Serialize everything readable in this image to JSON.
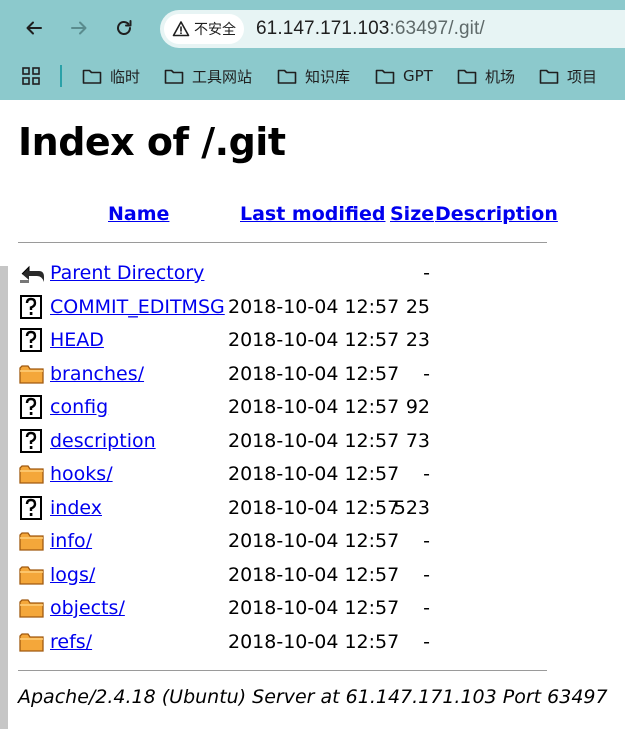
{
  "browser": {
    "security_label": "不安全",
    "url_host": "61.147.171.103",
    "url_rest": ":63497/.git/",
    "bookmarks": [
      {
        "label": "临时"
      },
      {
        "label": "工具网站"
      },
      {
        "label": "知识库"
      },
      {
        "label": "GPT"
      },
      {
        "label": "机场"
      },
      {
        "label": "项目"
      }
    ]
  },
  "page": {
    "title": "Index of /.git",
    "columns": {
      "name": "Name",
      "last_modified": "Last modified",
      "size": "Size",
      "description": "Description"
    },
    "rows": [
      {
        "icon": "back-icon",
        "name": "Parent Directory",
        "date": "",
        "size": "-"
      },
      {
        "icon": "unknown-file-icon",
        "name": "COMMIT_EDITMSG",
        "date": "2018-10-04 12:57",
        "size": "25"
      },
      {
        "icon": "unknown-file-icon",
        "name": "HEAD",
        "date": "2018-10-04 12:57",
        "size": "23"
      },
      {
        "icon": "folder-icon",
        "name": "branches/",
        "date": "2018-10-04 12:57",
        "size": "-"
      },
      {
        "icon": "unknown-file-icon",
        "name": "config",
        "date": "2018-10-04 12:57",
        "size": "92"
      },
      {
        "icon": "unknown-file-icon",
        "name": "description",
        "date": "2018-10-04 12:57",
        "size": "73"
      },
      {
        "icon": "folder-icon",
        "name": "hooks/",
        "date": "2018-10-04 12:57",
        "size": "-"
      },
      {
        "icon": "unknown-file-icon",
        "name": "index",
        "date": "2018-10-04 12:57",
        "size": "523"
      },
      {
        "icon": "folder-icon",
        "name": "info/",
        "date": "2018-10-04 12:57",
        "size": "-"
      },
      {
        "icon": "folder-icon",
        "name": "logs/",
        "date": "2018-10-04 12:57",
        "size": "-"
      },
      {
        "icon": "folder-icon",
        "name": "objects/",
        "date": "2018-10-04 12:57",
        "size": "-"
      },
      {
        "icon": "folder-icon",
        "name": "refs/",
        "date": "2018-10-04 12:57",
        "size": "-"
      }
    ],
    "footer": "Apache/2.4.18 (Ubuntu) Server at 61.147.171.103 Port 63497"
  },
  "colors": {
    "chrome_bg": "#8cc9cc",
    "link": "#0000ee",
    "folder": "#f0a030"
  }
}
